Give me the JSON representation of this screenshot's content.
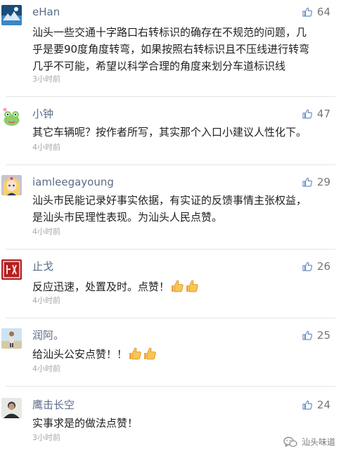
{
  "comments": [
    {
      "name": "eHan",
      "likes": "64",
      "lines": [
        "汕头一些交通十字路口右转标识的确存在不规范的问题，几",
        "乎是要90度角度转弯，如果按照右转标识且不压线进行转弯",
        "几乎不可能，希望以科学合理的角度来划分车道标识线"
      ],
      "time": "3小时前",
      "avatar_icon": "landscape-avatar-icon"
    },
    {
      "name": "小钟",
      "likes": "47",
      "lines": [
        "其它车辆呢？按作者所写，其实那个入口小建议人性化下。"
      ],
      "time": "4小时前",
      "avatar_icon": "cartoon-frog-avatar-icon"
    },
    {
      "name": "iamleegayoung",
      "likes": "29",
      "lines": [
        "汕头市民能记录好事实依据，有实证的反馈事情主张权益，",
        "是汕头市民理性表现。为汕头人民点赞。"
      ],
      "time": "4小时前",
      "avatar_icon": "anime-avatar-icon"
    },
    {
      "name": "止戈",
      "likes": "26",
      "lines": [
        "反应迅速，处置及时。点赞！"
      ],
      "time": "4小时前",
      "avatar_icon": "red-seal-avatar-icon",
      "thumbs": 2
    },
    {
      "name": "润阿。",
      "likes": "25",
      "lines": [
        "给汕头公安点赞！！"
      ],
      "time": "4小时前",
      "avatar_icon": "beach-person-avatar-icon",
      "thumbs": 2
    },
    {
      "name": "鹰击长空",
      "likes": "24",
      "lines": [
        "实事求是的做法点赞！"
      ],
      "time": "3小时前",
      "avatar_icon": "person-portrait-avatar-icon"
    }
  ],
  "watermark": {
    "text": "汕头味道",
    "icon": "wechat-logo-icon"
  },
  "colors": {
    "name": "#5a6c88",
    "like_icon": "#6b8fc4",
    "time": "#a8a8a8",
    "divider": "#e4e4e4"
  }
}
